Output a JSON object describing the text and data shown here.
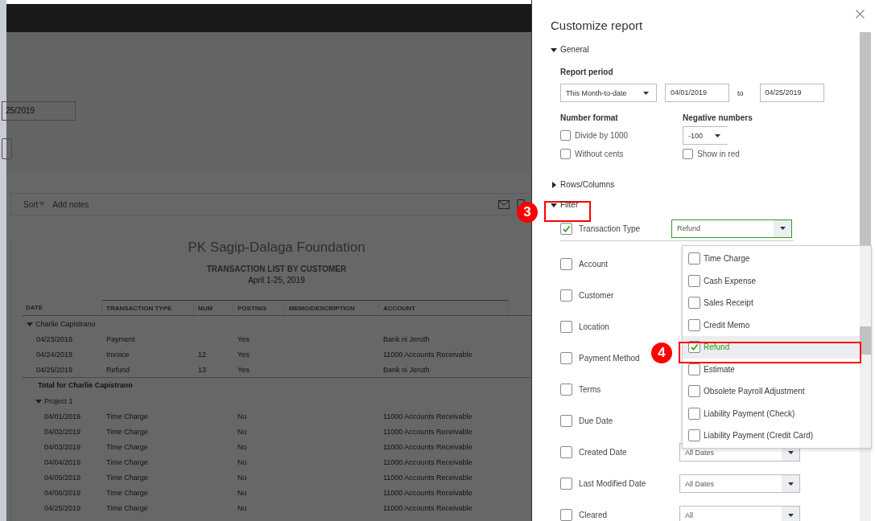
{
  "page": {
    "date_field": {
      "value": "25/2019"
    },
    "toolbar": {
      "sort": "Sort",
      "add_notes": "Add notes"
    }
  },
  "report": {
    "company": "PK Sagip-Dalaga Foundation",
    "title": "TRANSACTION LIST BY CUSTOMER",
    "date_range": "April 1-25, 2019",
    "columns": [
      "DATE",
      "TRANSACTION TYPE",
      "NUM",
      "POSTING",
      "MEMO/DESCRIPTION",
      "ACCOUNT"
    ],
    "rows": [
      {
        "kind": "group",
        "label": "Charlie Capistrano",
        "expanded": true,
        "children": [
          {
            "kind": "row",
            "date": "04/23/2019",
            "type": "Payment",
            "posting": "Yes",
            "account": "Bank ni Jeruth"
          },
          {
            "kind": "row",
            "date": "04/24/2019",
            "type": "Invoice",
            "num": "12",
            "posting": "Yes",
            "account": "11000 Accounts Receivable"
          },
          {
            "kind": "row",
            "date": "04/25/2019",
            "type": "Refund",
            "num": "13",
            "posting": "Yes",
            "account": "Bank ni Jeruth"
          },
          {
            "kind": "total",
            "label": "Total for Charlie Capistrano"
          },
          {
            "kind": "group",
            "label": "Project 1",
            "expanded": true,
            "children": [
              {
                "kind": "row",
                "date": "04/01/2019",
                "type": "Time Charge",
                "posting": "No",
                "account": "11000 Accounts Receivable"
              },
              {
                "kind": "row",
                "date": "04/02/2019",
                "type": "Time Charge",
                "posting": "No",
                "account": "11000 Accounts Receivable"
              },
              {
                "kind": "row",
                "date": "04/03/2019",
                "type": "Time Charge",
                "posting": "No",
                "account": "11000 Accounts Receivable"
              },
              {
                "kind": "row",
                "date": "04/04/2019",
                "type": "Time Charge",
                "posting": "No",
                "account": "11000 Accounts Receivable"
              },
              {
                "kind": "row",
                "date": "04/05/2019",
                "type": "Time Charge",
                "posting": "No",
                "account": "11000 Accounts Receivable"
              },
              {
                "kind": "row",
                "date": "04/06/2019",
                "type": "Time Charge",
                "posting": "No",
                "account": "11000 Accounts Receivable"
              },
              {
                "kind": "row",
                "date": "04/25/2019",
                "type": "Time Charge",
                "posting": "No",
                "account": "11000 Accounts Receivable"
              }
            ]
          }
        ]
      }
    ]
  },
  "customize_panel": {
    "title": "Customize report",
    "sections": [
      {
        "label": "General",
        "expanded": true
      },
      {
        "label": "Rows/Columns",
        "expanded": false
      },
      {
        "label": "Filter",
        "expanded": true
      }
    ],
    "report_period": {
      "label": "Report period",
      "period": "This Month-to-date",
      "from": "04/01/2019",
      "to_label": "to",
      "to": "04/25/2019"
    },
    "number_format": {
      "label": "Number format",
      "options": [
        {
          "label": "Divide by 1000",
          "checked": false
        },
        {
          "label": "Without cents",
          "checked": false
        }
      ]
    },
    "negative_numbers": {
      "label": "Negative numbers",
      "value": "-100",
      "show_in_red": {
        "label": "Show in red",
        "checked": false
      }
    },
    "filters": [
      {
        "label": "Transaction Type",
        "checked": true,
        "select": {
          "value": "Refund",
          "open": true
        }
      },
      {
        "label": "Account",
        "checked": false
      },
      {
        "label": "Customer",
        "checked": false
      },
      {
        "label": "Location",
        "checked": false
      },
      {
        "label": "Payment Method",
        "checked": false
      },
      {
        "label": "Terms",
        "checked": false
      },
      {
        "label": "Due Date",
        "checked": false
      },
      {
        "label": "Created Date",
        "checked": false,
        "select": {
          "value": "All Dates",
          "open": false
        }
      },
      {
        "label": "Last Modified Date",
        "checked": false,
        "select": {
          "value": "All Dates",
          "open": false
        }
      },
      {
        "label": "Cleared",
        "checked": false,
        "select": {
          "value": "All",
          "open": false
        }
      }
    ]
  },
  "filter_dropdown": {
    "items": [
      {
        "label": "Time Charge",
        "checked": false,
        "selected": false
      },
      {
        "label": "Cash Expense",
        "checked": false,
        "selected": false
      },
      {
        "label": "Sales Receipt",
        "checked": false,
        "selected": false
      },
      {
        "label": "Credit Memo",
        "checked": false,
        "selected": false
      },
      {
        "label": "Refund",
        "checked": true,
        "selected": true
      },
      {
        "label": "Estimate",
        "checked": false,
        "selected": false
      },
      {
        "label": "Obsolete Payroll Adjustment",
        "checked": false,
        "selected": false
      },
      {
        "label": "Liability Payment (Check)",
        "checked": false,
        "selected": false
      },
      {
        "label": "Liability Payment (Credit Card)",
        "checked": false,
        "selected": false
      }
    ]
  },
  "annotations": [
    {
      "number": "3"
    },
    {
      "number": "4"
    }
  ]
}
